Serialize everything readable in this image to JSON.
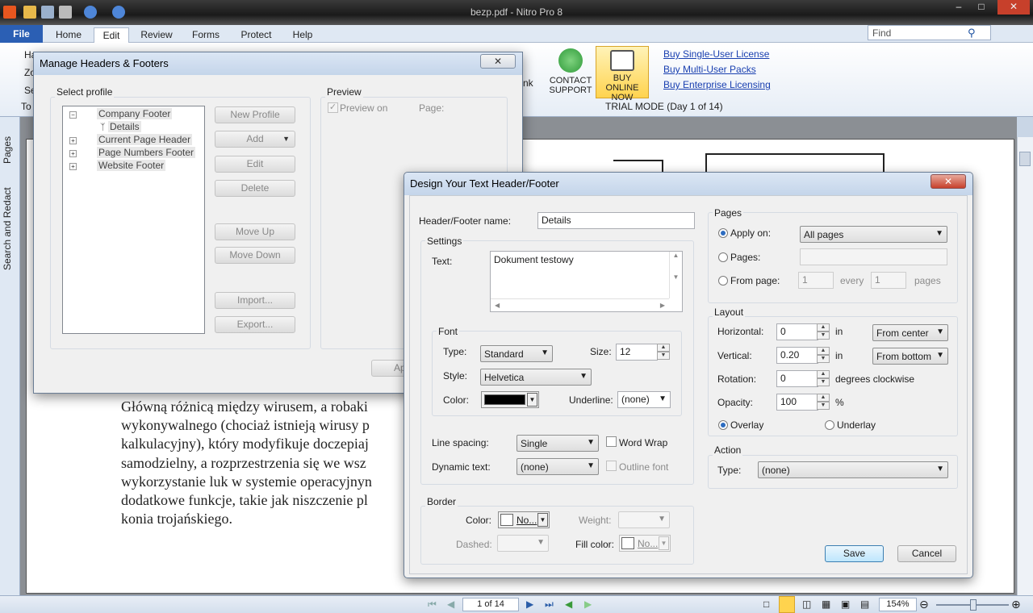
{
  "window": {
    "title": "bezp.pdf - Nitro Pro 8",
    "minimize": "–",
    "maximize": "□",
    "close": "✕"
  },
  "ribbon": {
    "tabs": [
      "File",
      "Home",
      "Edit",
      "Review",
      "Forms",
      "Protect",
      "Help"
    ],
    "active_tab": "Edit",
    "contact_label": "CONTACT SUPPORT",
    "buy_label": "BUY ONLINE NOW",
    "links": [
      "Buy Single-User License",
      "Buy Multi-User Packs",
      "Buy Enterprise Licensing"
    ],
    "trial": "TRIAL MODE (Day 1 of 14)",
    "find_placeholder": "Find",
    "partial_left": [
      "Ha",
      "Zo",
      "Se",
      "To"
    ],
    "partial_nk": "nk"
  },
  "left_panel": {
    "pages": "Pages",
    "search": "Search and Redact"
  },
  "document": {
    "lines": [
      "Główną różnicą między wirusem, a robaki",
      "wykonywalnego (chociaż istnieją wirusy p",
      "kalkulacyjny), który modyfikuje doczepiaj",
      "samodzielny, a rozprzestrzenia się we wsz",
      "wykorzystanie luk w systemie operacyjnyn",
      "dodatkowe funkcje, takie jak niszczenie pl",
      "konia trojańskiego."
    ]
  },
  "statusbar": {
    "page_field": "1 of 14",
    "zoom": "154%"
  },
  "manage_dialog": {
    "title": "Manage Headers & Footers",
    "close": "✕",
    "select_profile": "Select profile",
    "tree": [
      {
        "label": "Company Footer",
        "expanded": true
      },
      {
        "label": "Details",
        "child": true
      },
      {
        "label": "Current Page Header",
        "expanded": false
      },
      {
        "label": "Page Numbers Footer",
        "expanded": false
      },
      {
        "label": "Website Footer",
        "expanded": false
      }
    ],
    "buttons": {
      "new_profile": "New Profile",
      "add": "Add",
      "edit": "Edit",
      "delete": "Delete",
      "move_up": "Move Up",
      "move_down": "Move Down",
      "import": "Import...",
      "export": "Export...",
      "apply": "Appl"
    },
    "preview": "Preview",
    "preview_on": "Preview on",
    "page_label": "Page:"
  },
  "design_dialog": {
    "title": "Design Your Text Header/Footer",
    "close": "✕",
    "name_label": "Header/Footer name:",
    "name_value": "Details",
    "settings": "Settings",
    "text_label": "Text:",
    "text_value": "Dokument testowy",
    "font_group": "Font",
    "type_label": "Type:",
    "type_value": "Standard",
    "size_label": "Size:",
    "size_value": "12",
    "style_label": "Style:",
    "style_value": "Helvetica",
    "color_label": "Color:",
    "font_color": "#000000",
    "underline_label": "Underline:",
    "underline_value": "(none)",
    "line_spacing_label": "Line spacing:",
    "line_spacing_value": "Single",
    "word_wrap": "Word Wrap",
    "dynamic_text_label": "Dynamic text:",
    "dynamic_text_value": "(none)",
    "outline_font": "Outline font",
    "border_group": "Border",
    "border_color_label": "Color:",
    "border_color_value": "No...",
    "weight_label": "Weight:",
    "dashed_label": "Dashed:",
    "fill_color_label": "Fill color:",
    "fill_color_value": "No...",
    "pages_group": "Pages",
    "apply_on": "Apply on:",
    "apply_on_value": "All pages",
    "pages_radio": "Pages:",
    "from_page": "From page:",
    "from_page_value": "1",
    "every": "every",
    "every_value": "1",
    "pages_suffix": "pages",
    "layout_group": "Layout",
    "horizontal_label": "Horizontal:",
    "horizontal_value": "0",
    "horizontal_unit": "in",
    "horizontal_ref": "From center",
    "vertical_label": "Vertical:",
    "vertical_value": "0.20",
    "vertical_unit": "in",
    "vertical_ref": "From bottom",
    "rotation_label": "Rotation:",
    "rotation_value": "0",
    "rotation_unit": "degrees clockwise",
    "opacity_label": "Opacity:",
    "opacity_value": "100",
    "opacity_unit": "%",
    "overlay": "Overlay",
    "underlay": "Underlay",
    "action_group": "Action",
    "action_type_label": "Type:",
    "action_type_value": "(none)",
    "save": "Save",
    "cancel": "Cancel"
  }
}
